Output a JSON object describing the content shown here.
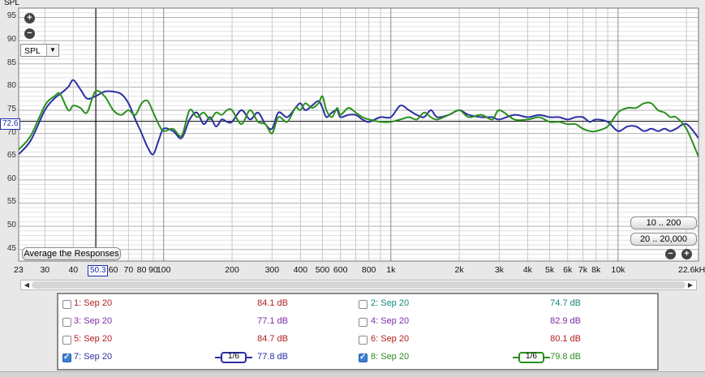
{
  "plot": {
    "y_axis_unit": "SPL",
    "y_ticks": [
      "95",
      "90",
      "85",
      "80",
      "75",
      "70",
      "65",
      "60",
      "55",
      "50",
      "45"
    ],
    "x_ticks": [
      "23",
      "30",
      "40",
      "50.3",
      "60",
      "70",
      "80",
      "90",
      "100",
      "200",
      "300",
      "400",
      "500",
      "600",
      "800",
      "1k",
      "2k",
      "3k",
      "4k",
      "5k",
      "6k",
      "7k",
      "8k",
      "10k",
      "22.6kHz"
    ],
    "cursor_level": "72.6",
    "cursor_freq": "50.3",
    "mode_select": "SPL",
    "zoom_in_label": "+",
    "zoom_out_label": "−",
    "average_button": "Average the Responses",
    "range_button_1": "10 .. 200",
    "range_button_2": "20 .. 20,000",
    "colors": {
      "blue_trace": "#2b2fa3",
      "green_trace": "#2a8f1e",
      "cursor": "#000000",
      "grid": "#c8c8c8"
    }
  },
  "chart_data": {
    "type": "line",
    "xscale": "log",
    "xlim": [
      23,
      22600
    ],
    "ylim": [
      42.5,
      97
    ],
    "series": [
      {
        "x": [
          23,
          26,
          30,
          33,
          35,
          38,
          40,
          43,
          46,
          50,
          55,
          60,
          65,
          70,
          75,
          80,
          85,
          90,
          95,
          100,
          110,
          120,
          130,
          140,
          150,
          160,
          170,
          180,
          190,
          200,
          220,
          240,
          260,
          280,
          300,
          320,
          350,
          380,
          400,
          420,
          450,
          480,
          500,
          520,
          550,
          580,
          600,
          650,
          700,
          750,
          800,
          900,
          1000,
          1100,
          1200,
          1300,
          1400,
          1500,
          1600,
          1800,
          2000,
          2200,
          2500,
          2800,
          3000,
          3500,
          4000,
          4500,
          5000,
          5500,
          6000,
          6500,
          7000,
          7500,
          8000,
          9000,
          10000,
          11000,
          12000,
          13000,
          14000,
          15000,
          16000,
          17000,
          18000,
          20000,
          22600
        ],
        "y": [
          65.5,
          68.5,
          75,
          77.5,
          78.5,
          80,
          81.5,
          79.5,
          77.5,
          78,
          79,
          79,
          78.5,
          76.5,
          73,
          70,
          67,
          65.5,
          68.5,
          71,
          70.5,
          69,
          73,
          74.5,
          72,
          73.5,
          71.5,
          73,
          72.5,
          72.5,
          75,
          73,
          74.5,
          72,
          71,
          74.5,
          73.5,
          75.5,
          76.5,
          75,
          76,
          77,
          75.5,
          73.5,
          74.5,
          75,
          73.5,
          74,
          74,
          73,
          72.5,
          73.5,
          73.5,
          76,
          75,
          74,
          73.5,
          75,
          73.5,
          74,
          75,
          74,
          73.5,
          73.5,
          73,
          74,
          73.5,
          74,
          73.5,
          73.5,
          73,
          73.5,
          73.5,
          72.5,
          73,
          72.5,
          70.5,
          71.5,
          71.5,
          70.5,
          71,
          70.5,
          71,
          70.5,
          71,
          72,
          69
        ]
      },
      {
        "x": [
          23,
          26,
          30,
          33,
          35,
          38,
          40,
          43,
          46,
          50,
          55,
          60,
          65,
          70,
          75,
          80,
          85,
          90,
          95,
          100,
          110,
          120,
          130,
          140,
          150,
          160,
          170,
          180,
          190,
          200,
          220,
          240,
          260,
          280,
          300,
          320,
          350,
          380,
          400,
          420,
          450,
          480,
          500,
          520,
          550,
          580,
          600,
          650,
          700,
          750,
          800,
          900,
          1000,
          1100,
          1200,
          1300,
          1400,
          1500,
          1600,
          1800,
          2000,
          2200,
          2500,
          2800,
          3000,
          3500,
          4000,
          4500,
          5000,
          5500,
          6000,
          6500,
          7000,
          7500,
          8000,
          9000,
          10000,
          11000,
          12000,
          13000,
          14000,
          15000,
          16000,
          17000,
          18000,
          20000,
          22600
        ],
        "y": [
          66.5,
          69.5,
          76,
          78,
          78.5,
          75,
          76,
          75.5,
          74.5,
          79,
          78,
          75,
          74,
          75,
          74,
          76.5,
          77,
          74.5,
          72,
          70.5,
          71,
          69.5,
          75,
          73.5,
          74.5,
          73,
          74.5,
          74,
          75,
          75,
          72,
          75,
          72.5,
          72,
          70,
          73.5,
          72.5,
          75.5,
          75,
          76.5,
          75.5,
          76.5,
          78,
          75,
          73.5,
          75.5,
          74,
          75.5,
          74.5,
          73.5,
          73,
          72.5,
          72.5,
          73,
          73.5,
          73,
          74.5,
          73.5,
          73,
          74,
          75,
          73.5,
          74,
          73,
          75,
          73,
          73,
          73.5,
          72.5,
          72.5,
          72,
          72,
          71,
          70.5,
          70.5,
          71.5,
          74.5,
          75.5,
          75.5,
          76.5,
          76.5,
          75,
          74.5,
          73.5,
          73.5,
          71,
          65
        ]
      }
    ]
  },
  "scrollbar": {
    "left_arrow": "◀",
    "right_arrow": "▶"
  },
  "legend": {
    "rows": [
      {
        "left": {
          "name": "1: Sep 20",
          "db": "84.1 dB",
          "checked": false,
          "color": "#b02020"
        },
        "right": {
          "name": "2: Sep 20",
          "db": "74.7 dB",
          "checked": false,
          "color": "#12877a"
        }
      },
      {
        "left": {
          "name": "3: Sep 20",
          "db": "77.1 dB",
          "checked": false,
          "color": "#7d2aa8"
        },
        "right": {
          "name": "4: Sep 20",
          "db": "82.9 dB",
          "checked": false,
          "color": "#7d2aa8"
        }
      },
      {
        "left": {
          "name": "5: Sep 20",
          "db": "84.7 dB",
          "checked": false,
          "color": "#b02020"
        },
        "right": {
          "name": "6: Sep 20",
          "db": "80.1 dB",
          "checked": false,
          "color": "#b02020"
        }
      },
      {
        "left": {
          "name": "7: Sep 20",
          "db": "77.8 dB",
          "checked": true,
          "color": "#2b2fa3",
          "smoothing": "1/6"
        },
        "right": {
          "name": "8: Sep 20",
          "db": "79.8 dB",
          "checked": true,
          "color": "#2a8f1e",
          "smoothing": "1/6"
        }
      }
    ]
  }
}
